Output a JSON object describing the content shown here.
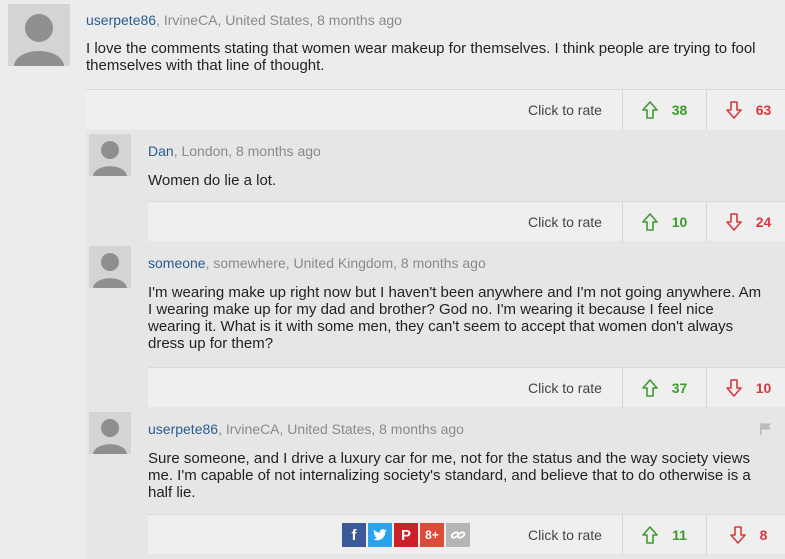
{
  "rate_label": "Click to rate",
  "comments": [
    {
      "user": "userpete86",
      "meta": ", IrvineCA, United States, 8 months ago",
      "text": "I love the comments stating that women wear makeup for themselves. I think people are trying to fool themselves with that line of thought.",
      "up": "38",
      "down": "63"
    },
    {
      "user": "Dan",
      "meta": ", London, 8 months ago",
      "text": "Women do lie a lot.",
      "up": "10",
      "down": "24"
    },
    {
      "user": "someone",
      "meta": ", somewhere, United Kingdom, 8 months ago",
      "text": "I'm wearing make up right now but I haven't been anywhere and I'm not going anywhere. Am I wearing make up for my dad and brother? God no. I'm wearing it because I feel nice wearing it. What is it with some men, they can't seem to accept that women don't always dress up for them?",
      "up": "37",
      "down": "10"
    },
    {
      "user": "userpete86",
      "meta": ", IrvineCA, United States, 8 months ago",
      "text": "Sure someone, and I drive a luxury car for me, not for the status and the way society views me. I'm capable of not internalizing society's standard, and believe that to do otherwise is a half lie.",
      "up": "11",
      "down": "8"
    }
  ],
  "share": {
    "facebook": "f",
    "twitter": "t",
    "pinterest": "P",
    "googleplus": "8+",
    "link": "link"
  },
  "colors": {
    "up": "#3c9c2c",
    "down": "#d8383f",
    "username": "#2a5c8f",
    "facebook": "#3b5998",
    "twitter": "#2aa3ef",
    "pinterest": "#cb2027",
    "googleplus": "#dd4b39"
  }
}
